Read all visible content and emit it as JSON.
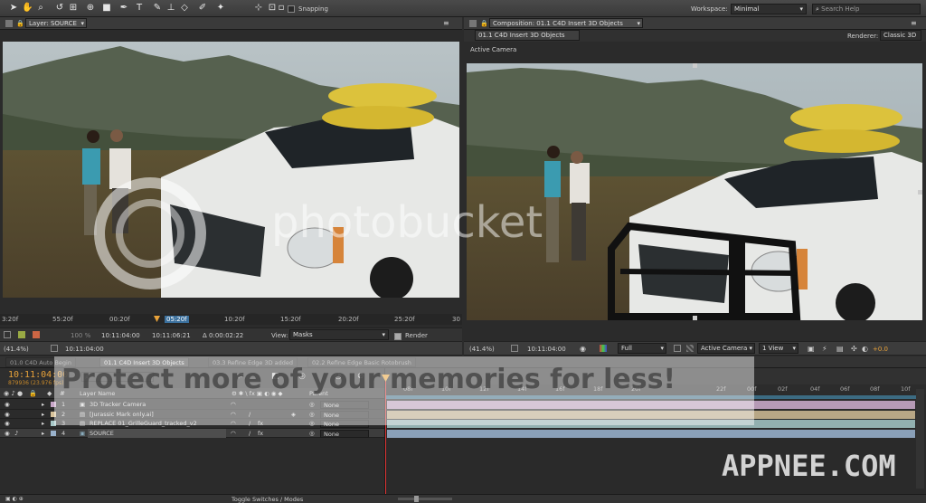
{
  "toolbar": {
    "snapping_label": "Snapping",
    "workspace_label": "Workspace:",
    "workspace_value": "Minimal",
    "search_placeholder": "Search Help"
  },
  "layer_panel": {
    "tab_label": "Layer: SOURCE",
    "ruler_ticks": [
      "3:20f",
      "55:20f",
      "00:20f",
      "05:20f",
      "10:20f",
      "15:20f",
      "20:20f",
      "25:20f",
      "30"
    ],
    "current_time_tick": "05:20f",
    "controls": {
      "zoom": "(41.4%)",
      "zoom_percent": "100 %",
      "time_current": "10:11:04:00",
      "time_in": "10:11:04:00",
      "time_out": "10:11:06:21",
      "duration": "Δ 0:00:02:22",
      "view_label": "View:",
      "view_value": "Masks",
      "render_label": "Render"
    }
  },
  "comp_panel": {
    "tab_label": "Composition: 01.1 C4D Insert 3D Objects",
    "subtab_label": "01.1 C4D Insert 3D Objects",
    "renderer_label": "Renderer:",
    "renderer_value": "Classic 3D",
    "camera_label": "Active Camera",
    "controls": {
      "zoom": "(41.4%)",
      "time": "10:11:04:00",
      "resolution": "Full",
      "camera_select": "Active Camera",
      "view_count": "1 View",
      "exposure": "+0.0"
    }
  },
  "timeline": {
    "tabs": [
      "01.0 C4D Auto Begin",
      "01.1 C4D Insert 3D Objects",
      "03.3 Refine Edge 3D added",
      "02.2 Refine Edge Basic Rotobrush"
    ],
    "timecode": "10:11:04:00",
    "frame_info": "879936 (23.976 fps)",
    "search_placeholder": "",
    "column_layer_name": "Layer Name",
    "column_parent": "Parent",
    "ruler_ticks": [
      "08f",
      "10f",
      "12f",
      "14f",
      "16f",
      "18f",
      "20f",
      "22f",
      "00f",
      "02f",
      "04f",
      "06f",
      "08f",
      "10f"
    ],
    "layers": [
      {
        "num": "1",
        "name": "3D Tracker Camera",
        "parent": "None",
        "color": "#c9a7c9"
      },
      {
        "num": "2",
        "name": "[Jurassic Mark only.ai]",
        "parent": "None",
        "color": "#d7c29a"
      },
      {
        "num": "3",
        "name": "REPLACE 01_GrilleGuard_tracked_v2",
        "parent": "None",
        "color": "#a8c8c8"
      },
      {
        "num": "4",
        "name": "SOURCE",
        "parent": "None",
        "color": "#9ab2cc"
      }
    ],
    "toggle_label": "Toggle Switches / Modes"
  },
  "watermarks": {
    "photobucket": "photobucket",
    "protect": "Protect more of your memories for less!",
    "appnee": "APPNEE.COM"
  },
  "colors": {
    "panel_bg": "#2b2b2b",
    "accent_orange": "#e8a23a",
    "sky": "#a7b3b9"
  }
}
